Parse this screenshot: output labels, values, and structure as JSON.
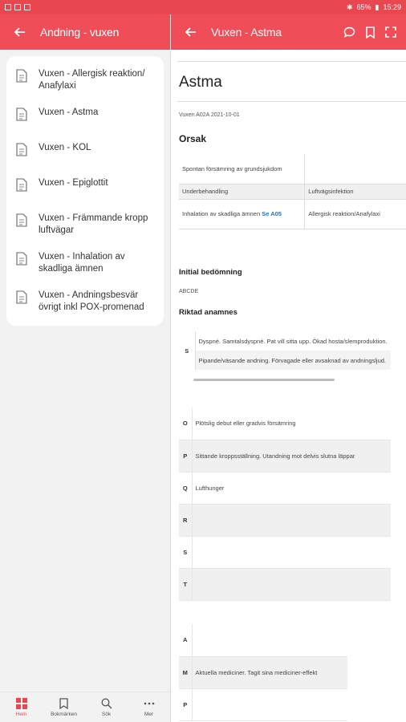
{
  "status": {
    "battery": "65%",
    "time": "15:29"
  },
  "left_header": {
    "title": "Andning - vuxen"
  },
  "right_header": {
    "title": "Vuxen - Astma"
  },
  "menu": {
    "items": [
      {
        "label": "Vuxen - Allergisk reaktion/ Anafylaxi"
      },
      {
        "label": "Vuxen - Astma"
      },
      {
        "label": "Vuxen - KOL"
      },
      {
        "label": "Vuxen - Epiglottit"
      },
      {
        "label": "Vuxen - Främmande kropp luftvägar"
      },
      {
        "label": "Vuxen - Inhalation av skadliga ämnen"
      },
      {
        "label": "Vuxen - Andningsbesvär övrigt inkl POX-promenad"
      }
    ]
  },
  "bottom_nav": [
    {
      "label": "Hem"
    },
    {
      "label": "Bokmärken"
    },
    {
      "label": "Sök"
    },
    {
      "label": "Mer"
    }
  ],
  "doc": {
    "title": "Astma",
    "meta": "Vuxen A02A 2021-10-01",
    "orsak_heading": "Orsak",
    "orsak_table": {
      "r1c1": "Spontan försämring av grundsjukdom",
      "r1c2": "",
      "r2c1": "Underbehandling",
      "r2c2": "Luftvägsinfektion",
      "r3c1_text": "Inhalation av skadliga ämnen ",
      "r3c1_link": "Se A05",
      "r3c2": "Allergisk reaktion/Anafylaxi"
    },
    "initial_heading": "Initial bedömning",
    "abcde": "ABCDE",
    "anamnes_heading": "Riktad anamnes",
    "s_table": {
      "key": "S",
      "row1": "Dyspné.  Samtalsdyspné.  Pat vill sitta upp.  Ökad hosta/slemproduktion.",
      "row2": "Pipande/väsande andning.  Förvagade eller avsaknad av andningsljud."
    },
    "opqrst": [
      {
        "key": "O",
        "text": "Plötslig debut eller gradvis försämring"
      },
      {
        "key": "P",
        "text": "Sittande kroppsställning. Utandning mot delvis slutna läppar"
      },
      {
        "key": "Q",
        "text": "Lufthunger"
      },
      {
        "key": "R",
        "text": ""
      },
      {
        "key": "S",
        "text": ""
      },
      {
        "key": "T",
        "text": ""
      }
    ],
    "ampl": [
      {
        "key": "A",
        "text": ""
      },
      {
        "key": "M",
        "text": "Aktuella mediciner. Tagit sina mediciner-effekt"
      },
      {
        "key": "P",
        "text": ""
      }
    ]
  }
}
